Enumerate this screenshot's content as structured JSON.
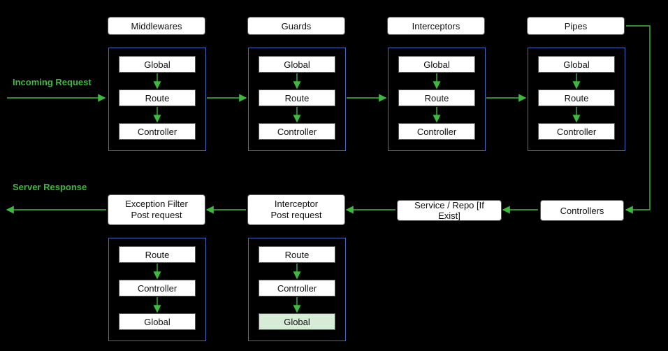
{
  "labels": {
    "incoming": "Incoming Request",
    "response": "Server Response"
  },
  "top_stages": [
    {
      "title": "Middlewares",
      "items": [
        "Global",
        "Route",
        "Controller"
      ]
    },
    {
      "title": "Guards",
      "items": [
        "Global",
        "Route",
        "Controller"
      ]
    },
    {
      "title": "Interceptors",
      "items": [
        "Global",
        "Route",
        "Controller"
      ]
    },
    {
      "title": "Pipes",
      "items": [
        "Global",
        "Route",
        "Controller"
      ]
    }
  ],
  "bottom_right_boxes": [
    "Controllers",
    "Service / Repo [If Exist]"
  ],
  "bottom_stages": [
    {
      "title_line1": "Interceptor",
      "title_line2": "Post request",
      "items": [
        "Route",
        "Controller",
        "Global"
      ],
      "highlight": "Global"
    },
    {
      "title_line1": "Exception Filter",
      "title_line2": "Post request",
      "items": [
        "Route",
        "Controller",
        "Global"
      ],
      "highlight": null
    }
  ],
  "colors": {
    "accent_green": "#3fb83f",
    "frame_blue": "#4a67c0"
  }
}
